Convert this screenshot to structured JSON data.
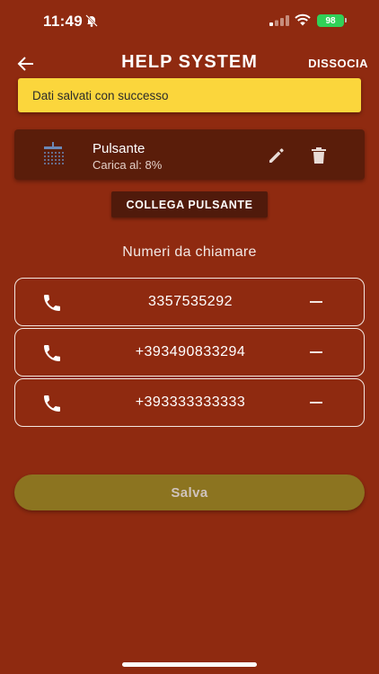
{
  "status_bar": {
    "time": "11:49",
    "battery": "98"
  },
  "appbar": {
    "title": "HELP SYSTEM",
    "action_label": "DISSOCIA"
  },
  "snackbar": {
    "message": "Dati salvati con successo"
  },
  "device": {
    "name": "Pulsante",
    "charge_label": "Carica al:",
    "charge_value": "8%"
  },
  "connect_button": {
    "label": "COLLEGA PULSANTE"
  },
  "numbers_section": {
    "title": "Numeri da chiamare",
    "numbers": [
      "3357535292",
      "+393490833294",
      "+393333333333"
    ]
  },
  "save_button": {
    "label": "Salva"
  },
  "icons": {
    "back": "arrow-left-icon",
    "device": "shower-icon",
    "edit": "pencil-icon",
    "delete": "trash-icon",
    "phone": "phone-icon",
    "remove": "minus-icon"
  },
  "colors": {
    "background": "#8f2a10",
    "snackbar": "#fbd63c",
    "card": "#5a1d0a",
    "save_button": "#8c7420",
    "battery": "#30d158"
  }
}
